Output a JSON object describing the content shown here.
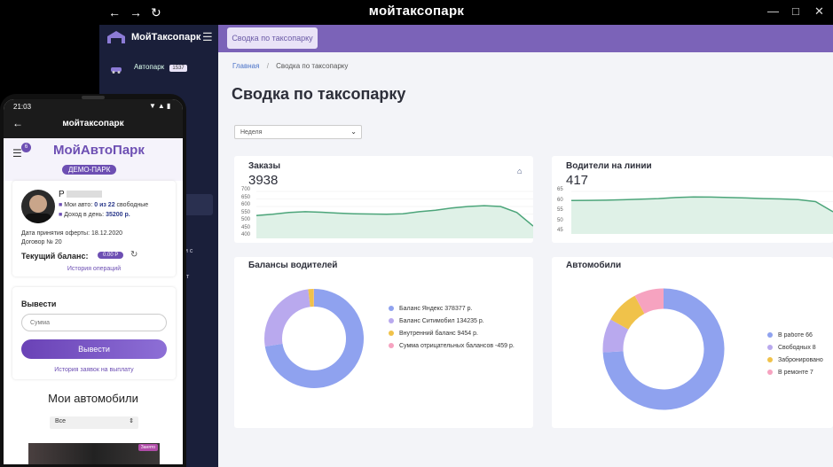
{
  "window": {
    "title": "мойтаксопарк"
  },
  "sidebar": {
    "brand": "МойТаксопарк",
    "item_autopark": "Автопарк",
    "item_autopark_count": "1537",
    "fragment_1": "и с",
    "fragment_2": "т"
  },
  "header": {
    "pill": "Сводка по таксопарку"
  },
  "breadcrumb": {
    "home": "Главная",
    "sep": "/",
    "current": "Сводка по таксопарку"
  },
  "page": {
    "title": "Сводка по таксопарку",
    "period_select": "Неделя"
  },
  "orders": {
    "title": "Заказы",
    "value": "3938",
    "yticks": [
      "700",
      "650",
      "600",
      "550",
      "500",
      "450",
      "400"
    ],
    "line": [
      540,
      548,
      560,
      565,
      562,
      556,
      552,
      550,
      548,
      552,
      565,
      575,
      590,
      600,
      605,
      600,
      560,
      470
    ]
  },
  "drivers_online": {
    "title": "Водители на линии",
    "value": "417",
    "yticks": [
      "65",
      "60",
      "55",
      "50",
      "45"
    ],
    "line": [
      60.5,
      60.6,
      60.7,
      60.9,
      61.2,
      61.5,
      62,
      62.3,
      62.2,
      62,
      61.8,
      61.5,
      61.3,
      61,
      60,
      55
    ]
  },
  "balances": {
    "title": "Балансы водителей",
    "legend": [
      {
        "label": "Баланс Яндекс 378377 р.",
        "color": "#8fa2ef",
        "value": 378377
      },
      {
        "label": "Баланс Ситимобил 134235 р.",
        "color": "#b9a9ee",
        "value": 134235
      },
      {
        "label": "Внутренний баланс 9454 р.",
        "color": "#f0c24a",
        "value": 9454
      },
      {
        "label": "Сумма отрицательных балансов -459 р.",
        "color": "#f6a3c0",
        "value": 459
      }
    ]
  },
  "cars": {
    "title": "Автомобили",
    "legend": [
      {
        "label": "В работе 66",
        "color": "#8fa2ef",
        "value": 66
      },
      {
        "label": "Свободных 8",
        "color": "#b9a9ee",
        "value": 8
      },
      {
        "label": "Забронировано",
        "color": "#f0c24a",
        "value": 8
      },
      {
        "label": "В ремонте 7",
        "color": "#f6a3c0",
        "value": 7
      }
    ]
  },
  "phone": {
    "time": "21:03",
    "app_title": "мойтаксопарк",
    "brand": "МойАвтоПарк",
    "badge": "ДЕМО-ПАРК",
    "menu_count": "6",
    "profile_name": "Р",
    "my_cars_label": "Мои авто:",
    "my_cars_value": "0 из 22",
    "my_cars_suffix": "свободные",
    "income_label": "Доход в день:",
    "income_value": "35200 р.",
    "offer_date": "Дата принятия оферты: 18.12.2020",
    "contract": "Договор № 20",
    "balance_label": "Текущий баланс:",
    "balance_value": "0.00 Р",
    "history_ops": "История операций",
    "withdraw_title": "Вывести",
    "amount_placeholder": "Сумма",
    "withdraw_button": "Вывести",
    "withdraw_history": "История заявок на выплату",
    "my_cars_title": "Мои автомобили",
    "filter": "Все",
    "busy_badge": "Занято"
  }
}
